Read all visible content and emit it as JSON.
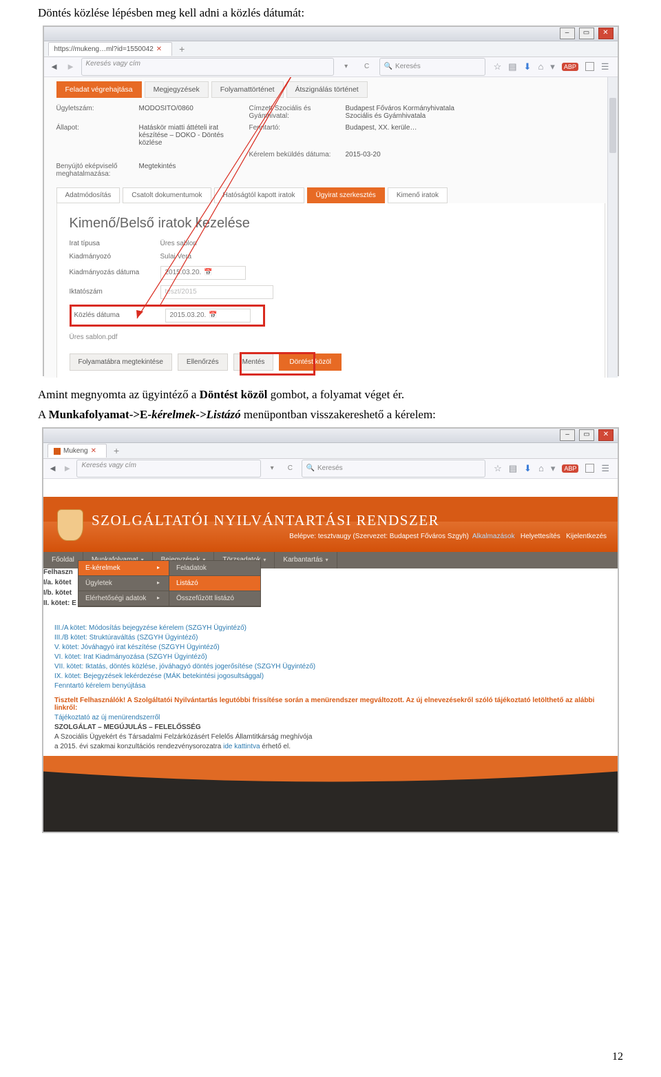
{
  "doc": {
    "p1": "Döntés közlése lépésben meg kell adni a közlés dátumát:",
    "p2a": "Amint megnyomta az ügyintéző a ",
    "p2b": "Döntést közöl",
    "p2c": " gombot, a folyamat véget ér.",
    "p3a": "A ",
    "p3b": "Munkafolyamat->E-",
    "p3c": "kérelmek->Listázó",
    "p3d": " menüpontban visszakereshető a kérelem:",
    "pagenum": "12"
  },
  "s1": {
    "tab": "https://mukeng…ml?id=1550042",
    "addr_placeholder": "Keresés vagy cím",
    "search_placeholder": "Keresés",
    "topTabs": [
      "Feladat végrehajtása",
      "Megjegyzések",
      "Folyamattörténet",
      "Átszignálás történet"
    ],
    "kv": {
      "ugyletszam_l": "Ügyletszám:",
      "ugyletszam_v": "MODOSITO/0860",
      "cimzett_l": "Címzett Szociális és Gyámhivatal:",
      "cimzett_v": "Budapest Főváros Kormányhivatala Szociális és Gyámhivatala",
      "allapot_l": "Állapot:",
      "allapot_v": "Hatáskör miatti áttételi irat készítése – DOKO - Döntés közlése",
      "fenntarto_l": "Fenntartó:",
      "fenntarto_v": "Budapest, XX. kerüle…",
      "kerelem_l": "Kérelem beküldés dátuma:",
      "kerelem_v": "2015-03-20",
      "benyujto_l": "Benyújtó eképviselő meghatalmazása:",
      "benyujto_v": "Megtekintés"
    },
    "subTabs": [
      "Adatmódosítás",
      "Csatolt dokumentumok",
      "Hatóságtól kapott iratok",
      "Ügyirat szerkesztés",
      "Kimenő iratok"
    ],
    "panelTitle": "Kimenő/Belső iratok kezelése",
    "rows": {
      "tipus_l": "Irat típusa",
      "tipus_v": "Üres sablon",
      "kiad_l": "Kiadmányozó",
      "kiad_v": "Sulai Vera",
      "kiaddate_l": "Kiadmányozás dátuma",
      "kiaddate_v": "2015.03.20.",
      "ikt_l": "Iktatószám",
      "ikt_v": "teszt/2015",
      "kozles_l": "Közlés dátuma",
      "kozles_v": "2015.03.20."
    },
    "file": "Üres sablon.pdf",
    "buttons": [
      "Folyamatábra megtekintése",
      "Ellenőrzés",
      "Mentés",
      "Döntést közöl"
    ]
  },
  "s2": {
    "tab": "Mukeng",
    "addr_placeholder": "Keresés vagy cím",
    "search_placeholder": "Keresés",
    "title": "SZOLGÁLTATÓI NYILVÁNTARTÁSI RENDSZER",
    "login_pre": "Belépve: tesztvaugy (Szervezet: Budapest Főváros Szgyh)",
    "toplinks": [
      "Alkalmazások",
      "Helyettesítés",
      "Kijelentkezés"
    ],
    "menu": [
      "Főoldal",
      "Munkafolyamat",
      "Bejegyzések",
      "Törzsadatok",
      "Karbantartás"
    ],
    "drop1": [
      {
        "l": "E-kérelmek",
        "sel": true,
        "car": true
      },
      {
        "l": "Ügyletek",
        "sel": false,
        "car": true
      },
      {
        "l": "Elérhetőségi adatok",
        "sel": false,
        "car": true
      }
    ],
    "drop2": [
      {
        "l": "Feladatok",
        "sel": false
      },
      {
        "l": "Listázó",
        "sel": true
      },
      {
        "l": "Összefűzött listázó",
        "sel": false
      }
    ],
    "leftList": [
      "Felhaszn",
      "I/a. kötet",
      "I/b. kötet",
      "II. kötet: E"
    ],
    "blueList": [
      "III./A kötet: Módosítás bejegyzése kérelem (SZGYH Ügyintéző)",
      "III./B kötet: Struktúraváltás (SZGYH Ügyintéző)",
      "V. kötet: Jóváhagyó irat készítése (SZGYH Ügyintéző)",
      "VI. kötet: Irat Kiadmányozása (SZGYH Ügyintéző)",
      "VII. kötet: Iktatás, döntés közlése, jóváhagyó döntés jogerősítése (SZGYH Ügyintéző)",
      "IX. kötet: Bejegyzések lekérdezése (MÁK betekintési jogosultsággal)",
      "Fenntartó kérelem benyújtása"
    ],
    "notice": "Tisztelt Felhasználók! A Szolgáltatói Nyilvántartás legutóbbi frissítése során a menürendszer megváltozott. Az új elnevezésekről szóló tájékoztató letölthető az alábbi linkről:",
    "tajlink": "Tájékoztató az új menürendszerről",
    "szolg": "SZOLGÁLAT – MEGÚJULÁS – FELELŐSSÉG",
    "line2": "A Szociális Ügyekért és Társadalmi Felzárkózásért Felelős Államtitkárság meghívója",
    "line3a": "a 2015. évi szakmai konzultációs rendezvénysorozatra ",
    "line3b": "ide kattintva",
    "line3c": " érhető el."
  }
}
